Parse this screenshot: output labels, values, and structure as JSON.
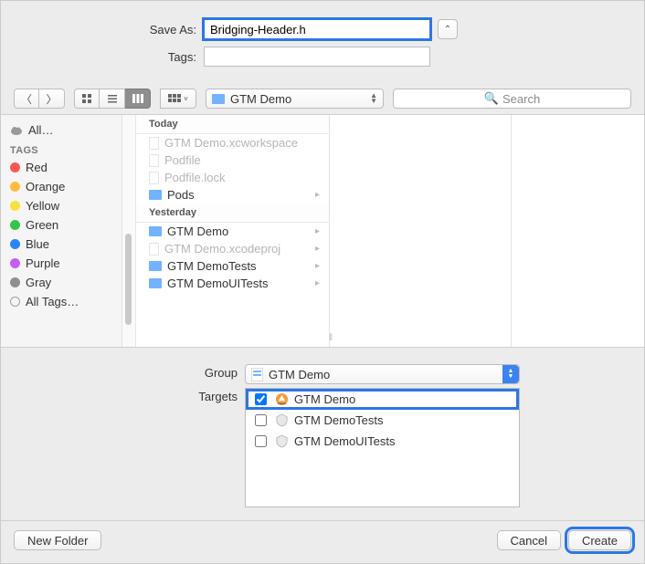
{
  "top": {
    "saveas_label": "Save As:",
    "saveas_value": "Bridging-Header.h",
    "tags_label": "Tags:",
    "tags_value": ""
  },
  "toolbar": {
    "location": "GTM Demo",
    "search_placeholder": "Search"
  },
  "sidebar": {
    "all": "All…",
    "tags_header": "Tags",
    "tags": [
      "Red",
      "Orange",
      "Yellow",
      "Green",
      "Blue",
      "Purple",
      "Gray"
    ],
    "all_tags": "All Tags…"
  },
  "files": {
    "groups": [
      {
        "title": "Today",
        "items": [
          "GTM Demo.xcworkspace",
          "Podfile",
          "Podfile.lock",
          "Pods"
        ]
      },
      {
        "title": "Yesterday",
        "items": [
          "GTM Demo",
          "GTM Demo.xcodeproj",
          "GTM DemoTests",
          "GTM DemoUITests"
        ]
      }
    ]
  },
  "bottom": {
    "group_label": "Group",
    "group_value": "GTM Demo",
    "targets_label": "Targets",
    "targets": [
      {
        "name": "GTM Demo",
        "checked": true
      },
      {
        "name": "GTM DemoTests",
        "checked": false
      },
      {
        "name": "GTM DemoUITests",
        "checked": false
      }
    ]
  },
  "buttons": {
    "new_folder": "New Folder",
    "cancel": "Cancel",
    "create": "Create"
  }
}
